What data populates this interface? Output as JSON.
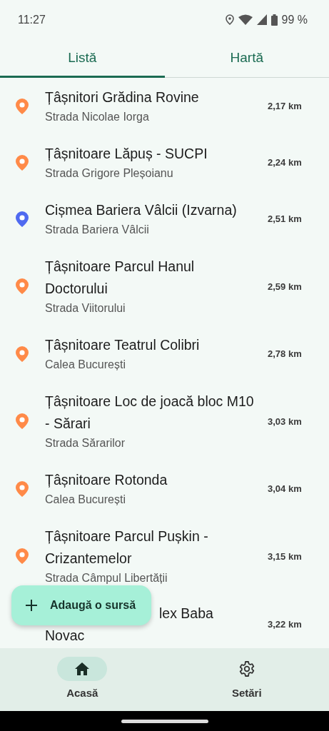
{
  "status_bar": {
    "time": "11:27",
    "battery": "99 %"
  },
  "tabs": [
    {
      "label": "Listă",
      "selected": true
    },
    {
      "label": "Hartă",
      "selected": false
    }
  ],
  "items": [
    {
      "title": "Țâșnitori Grădina Rovine",
      "street": "Strada Nicolae Iorga",
      "distance": "2,17 km",
      "color": "#ff8a48"
    },
    {
      "title": "Țâșnitoare Lăpuș - SUCPI",
      "street": "Strada Grigore Pleșoianu",
      "distance": "2,24 km",
      "color": "#ff8a48"
    },
    {
      "title": "Cișmea Bariera Vâlcii (Izvarna)",
      "street": "Strada Bariera Vâlcii",
      "distance": "2,51 km",
      "color": "#4f6af0"
    },
    {
      "title": "Țâșnitoare Parcul Hanul Doctorului",
      "street": "Strada Viitorului",
      "distance": "2,59 km",
      "color": "#ff8a48"
    },
    {
      "title": "Țâșnitoare Teatrul Colibri",
      "street": "Calea București",
      "distance": "2,78 km",
      "color": "#ff8a48"
    },
    {
      "title": "Țâșnitoare Loc de joacă bloc M10 - Sărari",
      "street": "Strada Sărarilor",
      "distance": "3,03 km",
      "color": "#ff8a48"
    },
    {
      "title": "Țâșnitoare Rotonda",
      "street": "Calea București",
      "distance": "3,04 km",
      "color": "#ff8a48"
    },
    {
      "title": "Țâșnitoare Parcul Pușkin - Crizantemelor",
      "street": "Strada Câmpul Libertății",
      "distance": "3,15 km",
      "color": "#ff8a48"
    },
    {
      "title_lines": [
        "lex Baba",
        "Novac"
      ],
      "distance": "3,22 km",
      "kind": "covered"
    }
  ],
  "fab": {
    "label": "Adaugă o sursă"
  },
  "nav": [
    {
      "label": "Acasă",
      "selected": true
    },
    {
      "label": "Setări",
      "selected": false
    }
  ]
}
